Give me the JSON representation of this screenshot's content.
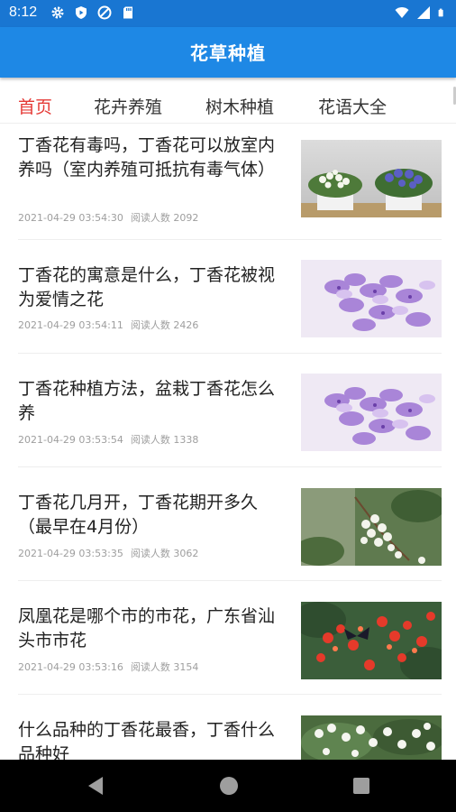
{
  "status_bar": {
    "time": "8:12",
    "left_icons": [
      "gear-icon",
      "shield-play-icon",
      "at-sign-icon",
      "sd-card-icon"
    ],
    "right_icons": [
      "wifi-icon",
      "signal-icon",
      "battery-icon"
    ]
  },
  "app_bar": {
    "title": "花草种植",
    "color": "#1e88e5"
  },
  "tabs": [
    {
      "label": "首页",
      "active": true
    },
    {
      "label": "花卉养殖",
      "active": false
    },
    {
      "label": "树木种植",
      "active": false
    },
    {
      "label": "花语大全",
      "active": false
    }
  ],
  "articles": [
    {
      "title": "丁香花有毒吗，丁香花可以放室内养吗（室内养殖可抵抗有毒气体）",
      "time": "2021-04-29 03:54:30",
      "reads": "阅读人数 2092",
      "image": "potted-lilac-plants-photo"
    },
    {
      "title": "丁香花的寓意是什么，丁香花被视为爱情之花",
      "time": "2021-04-29 03:54:11",
      "reads": "阅读人数 2426",
      "image": "purple-lilac-closeup-photo"
    },
    {
      "title": "丁香花种植方法，盆栽丁香花怎么养",
      "time": "2021-04-29 03:53:54",
      "reads": "阅读人数 1338",
      "image": "purple-lilac-closeup-photo"
    },
    {
      "title": "丁香花几月开，丁香花期开多久（最早在4月份）",
      "time": "2021-04-29 03:53:35",
      "reads": "阅读人数 3062",
      "image": "white-lilac-branch-photo"
    },
    {
      "title": "凤凰花是哪个市的市花，广东省汕头市市花",
      "time": "2021-04-29 03:53:16",
      "reads": "阅读人数 3154",
      "image": "red-phoenix-flowers-butterfly-photo"
    },
    {
      "title": "什么品种的丁香花最香，丁香什么品种好",
      "time": "",
      "reads": "",
      "image": "white-lilac-bush-photo"
    }
  ],
  "nav_bar": {
    "buttons": [
      "back-icon",
      "home-icon",
      "recents-icon"
    ]
  },
  "colors": {
    "status_bar": "#1976d2",
    "app_bar": "#1e88e5",
    "active_tab": "#e53935"
  }
}
